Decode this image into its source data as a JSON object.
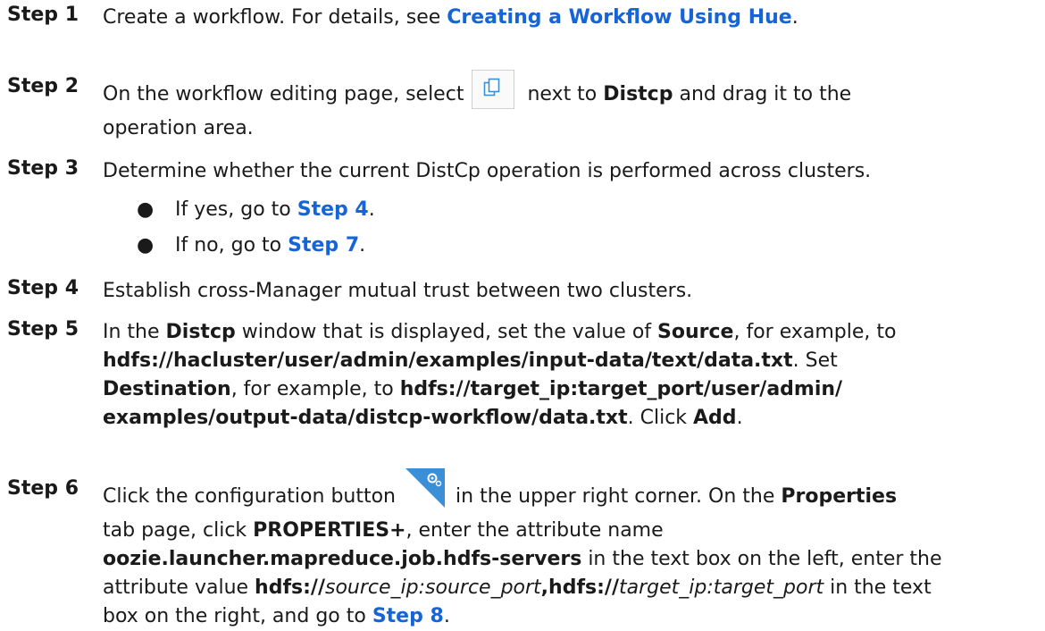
{
  "steps": [
    {
      "label": "Step 1",
      "p": [
        "Create a workflow. For details, see ",
        "Creating a Workflow Using Hue",
        "."
      ]
    },
    {
      "label": "Step 2",
      "line1": [
        "On the workflow editing page, select",
        "next to ",
        "Distcp",
        " and drag it to the"
      ],
      "line2": "operation area.",
      "icon": "copy-icon"
    },
    {
      "label": "Step 3",
      "p": "Determine whether the current DistCp operation is performed across clusters.",
      "bullets": [
        {
          "dot": "●",
          "pre": "If yes, go to ",
          "link": "Step 4",
          "post": "."
        },
        {
          "dot": "●",
          "pre": "If no, go to ",
          "link": "Step 7",
          "post": "."
        }
      ]
    },
    {
      "label": "Step 4",
      "p": "Establish cross-Manager mutual trust between two clusters."
    },
    {
      "label": "Step 5",
      "l1": [
        "In the ",
        "Distcp",
        " window that is displayed, set the value of ",
        "Source",
        ", for example, to"
      ],
      "l2": [
        "hdfs://hacluster/user/admin/examples/input-data/text/data.txt",
        ". Set"
      ],
      "l3": [
        "Destination",
        ", for example, to ",
        "hdfs://target_ip:target_port/user/admin/"
      ],
      "l4": [
        "examples/output-data/distcp-workflow/data.txt",
        ". Click ",
        "Add",
        "."
      ]
    },
    {
      "label": "Step 6",
      "l1": [
        "Click the configuration button",
        "in the upper right corner. On the ",
        "Properties"
      ],
      "l2": [
        "tab page, click ",
        "PROPERTIES+",
        ", enter the attribute name"
      ],
      "l3": [
        "oozie.launcher.mapreduce.job.hdfs-servers",
        " in the text box on the left, enter the"
      ],
      "l4": [
        "attribute value ",
        "hdfs://",
        "source_ip:source_port",
        ",hdfs://",
        "target_ip:target_port",
        " in the text"
      ],
      "l5": [
        "box on the right, and go to ",
        "Step 8",
        "."
      ],
      "icon": "gear-icon",
      "icon_color": "#3a8fd6"
    }
  ]
}
